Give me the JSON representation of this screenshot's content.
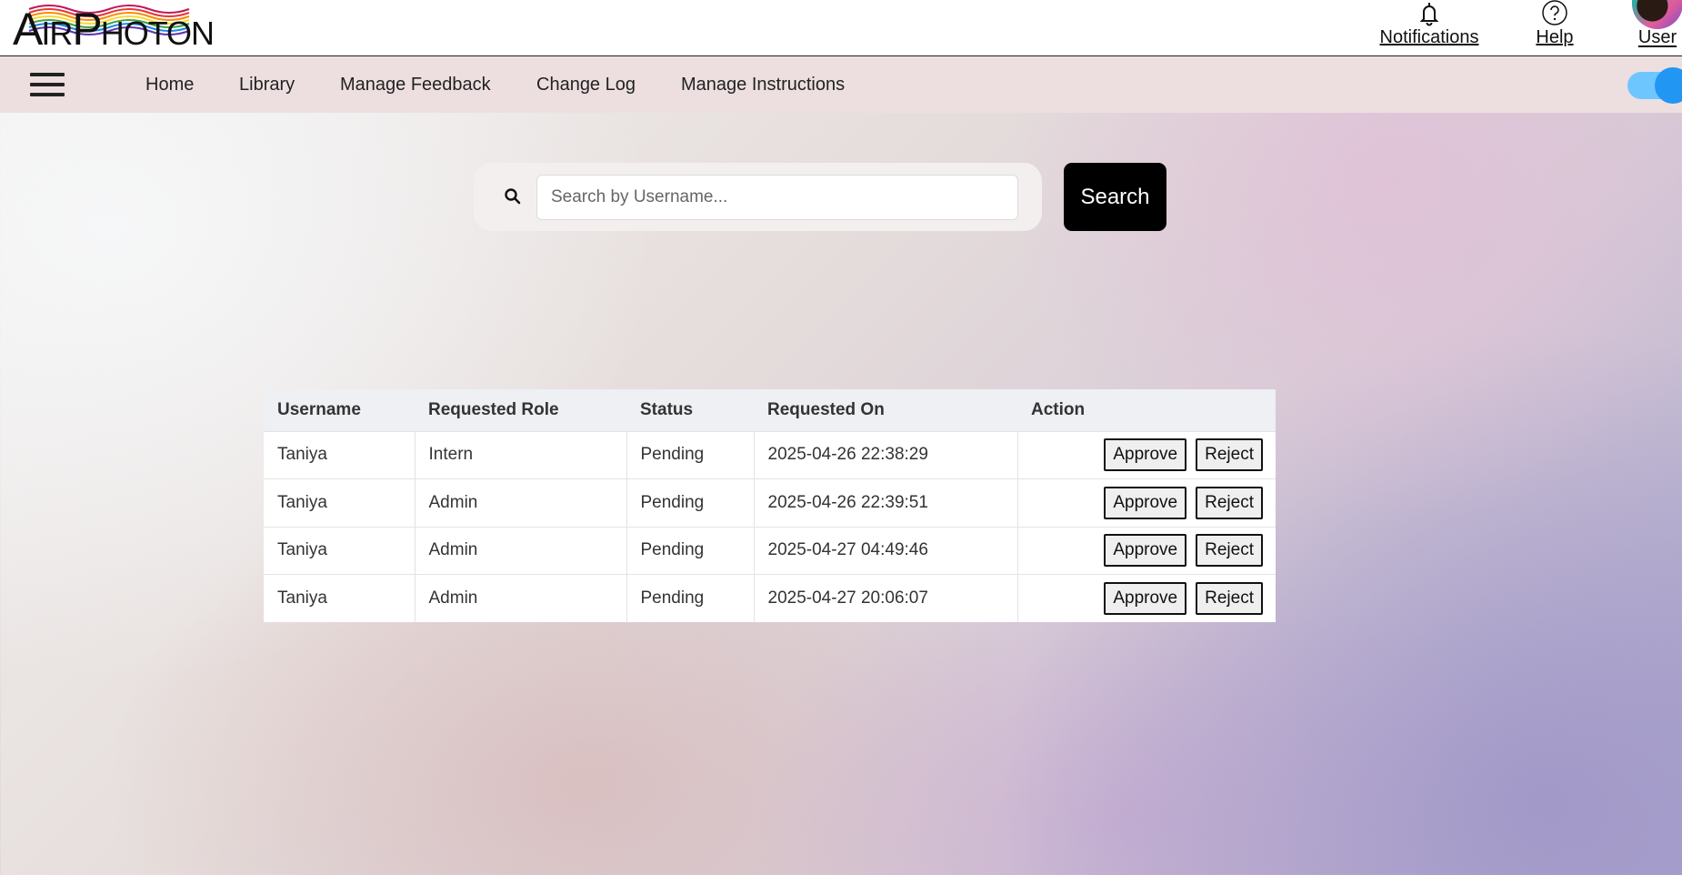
{
  "app": {
    "logo_text_1": "A",
    "logo_text_2": "IR",
    "logo_text_3": "P",
    "logo_text_4": "HOTON"
  },
  "header": {
    "notifications_label": "Notifications",
    "help_label": "Help",
    "user_label": "User"
  },
  "nav": {
    "items": [
      {
        "label": "Home"
      },
      {
        "label": "Library"
      },
      {
        "label": "Manage Feedback"
      },
      {
        "label": "Change Log"
      },
      {
        "label": "Manage Instructions"
      }
    ],
    "theme_toggle_on": true
  },
  "search": {
    "placeholder": "Search by Username...",
    "value": "",
    "button_label": "Search"
  },
  "table": {
    "columns": [
      "Username",
      "Requested Role",
      "Status",
      "Requested On",
      "Action"
    ],
    "rows": [
      {
        "username": "Taniya",
        "role": "Intern",
        "status": "Pending",
        "requested_on": "2025-04-26 22:38:29",
        "approve": "Approve",
        "reject": "Reject"
      },
      {
        "username": "Taniya",
        "role": "Admin",
        "status": "Pending",
        "requested_on": "2025-04-26 22:39:51",
        "approve": "Approve",
        "reject": "Reject"
      },
      {
        "username": "Taniya",
        "role": "Admin",
        "status": "Pending",
        "requested_on": "2025-04-27 04:49:46",
        "approve": "Approve",
        "reject": "Reject"
      },
      {
        "username": "Taniya",
        "role": "Admin",
        "status": "Pending",
        "requested_on": "2025-04-27 20:06:07",
        "approve": "Approve",
        "reject": "Reject"
      }
    ]
  },
  "colors": {
    "navbar_bg": "#eddfe0",
    "toggle_track": "#6ec6ff",
    "toggle_knob": "#2196f3",
    "search_button_bg": "#000000"
  }
}
